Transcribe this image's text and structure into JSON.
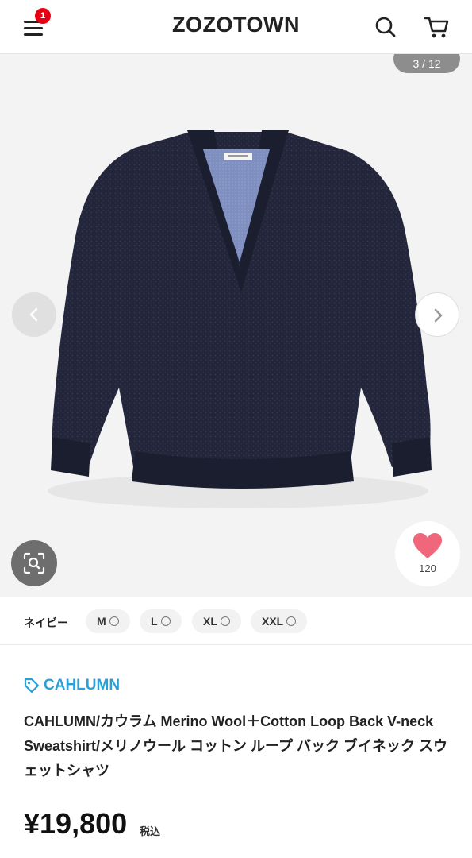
{
  "header": {
    "logo": "ZOZOTOWN",
    "menu_badge": "1"
  },
  "gallery": {
    "counter_text": "3 / 12",
    "favorite_count": "120"
  },
  "variant": {
    "color": "ネイビー",
    "sizes": [
      {
        "label": "M",
        "stock": "〇"
      },
      {
        "label": "L",
        "stock": "〇"
      },
      {
        "label": "XL",
        "stock": "〇"
      },
      {
        "label": "XXL",
        "stock": "〇"
      }
    ]
  },
  "product": {
    "brand": "CAHLUMN",
    "title": "CAHLUMN/カウラム Merino Wool＋Cotton Loop Back V-neck Sweatshirt/メリノウール コットン ループ バック ブイネック スウェットシャツ",
    "price": "¥19,800",
    "tax_label": "税込"
  },
  "colors": {
    "brand_link": "#2aa0d8",
    "badge": "#e60012",
    "heart": "#f0677c",
    "sweater": "#23263a",
    "collar_lining": "#7f90c0"
  },
  "icons": [
    "menu-icon",
    "search-icon",
    "cart-icon",
    "chevron-left-icon",
    "chevron-right-icon",
    "image-search-icon",
    "heart-icon",
    "tag-icon"
  ]
}
